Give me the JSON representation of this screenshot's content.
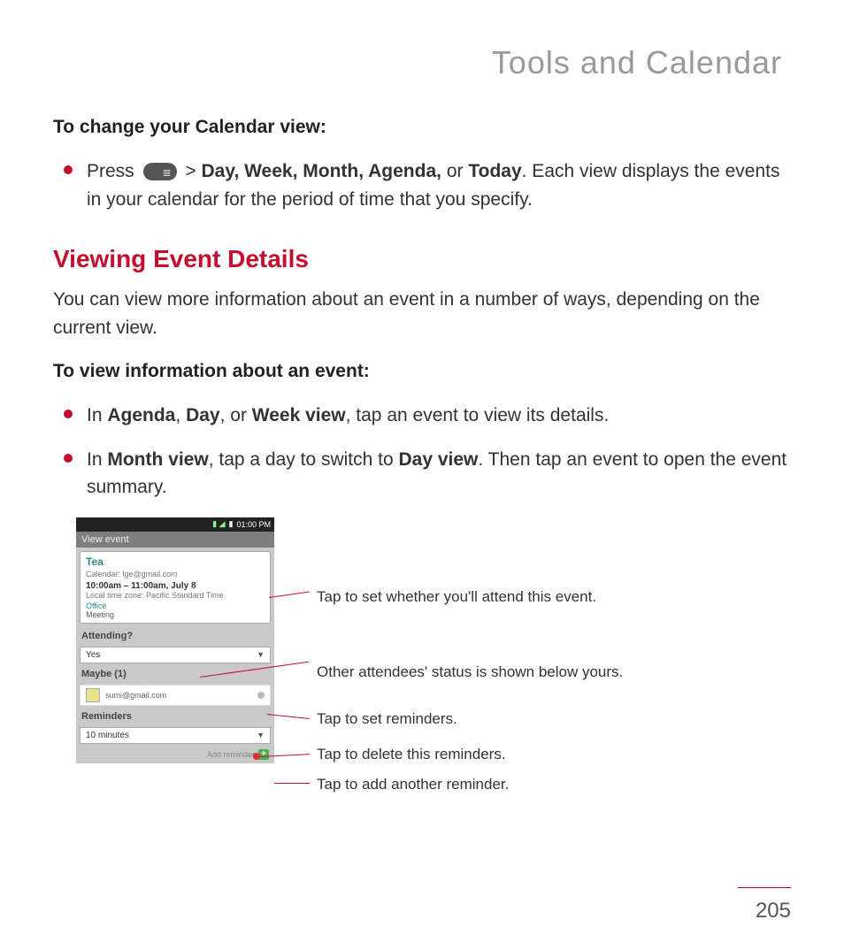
{
  "page_title": "Tools and Calendar",
  "sub1": "To change your Calendar view:",
  "bullet1_a": "Press",
  "bullet1_b": ">",
  "bullet1_c": "Day, Week, Month, Agenda,",
  "bullet1_d": "or",
  "bullet1_e": "Today",
  "bullet1_f": ". Each view displays the events in your calendar for the period of time that you specify.",
  "section_title": "Viewing Event Details",
  "para1": "You can view more information about an event in a number of ways, depending on the current view.",
  "sub2": "To view information about an event:",
  "bullet2_a": "In",
  "bullet2_b": "Agenda",
  "bullet2_c": ",",
  "bullet2_d": "Day",
  "bullet2_e": ", or",
  "bullet2_f": "Week view",
  "bullet2_g": ", tap an event to view its details.",
  "bullet3_a": "In",
  "bullet3_b": "Month view",
  "bullet3_c": ", tap a day to switch to",
  "bullet3_d": "Day view",
  "bullet3_e": ". Then tap an event to open the event summary.",
  "phone": {
    "time": "01:00 PM",
    "titlebar": "View event",
    "event_name": "Tea",
    "event_cal": "Calendar: lge@gmail.com",
    "event_time": "10:00am – 11:00am, July 8",
    "event_tz": "Local time zone:   Pacific Standard Time",
    "event_loc": "Office",
    "event_desc": "Meeting",
    "attending_label": "Attending?",
    "attending_value": "Yes",
    "maybe_label": "Maybe (1)",
    "attendee_email": "sumi@gmail.com",
    "reminders_label": "Reminders",
    "reminder_value": "10 minutes",
    "add_reminder": "Add reminder"
  },
  "callouts": {
    "c1": "Tap to set whether you'll attend this event.",
    "c2": "Other attendees' status is shown below yours.",
    "c3": "Tap to set reminders.",
    "c4": "Tap to delete this reminders.",
    "c5": "Tap to add another reminder."
  },
  "page_number": "205"
}
